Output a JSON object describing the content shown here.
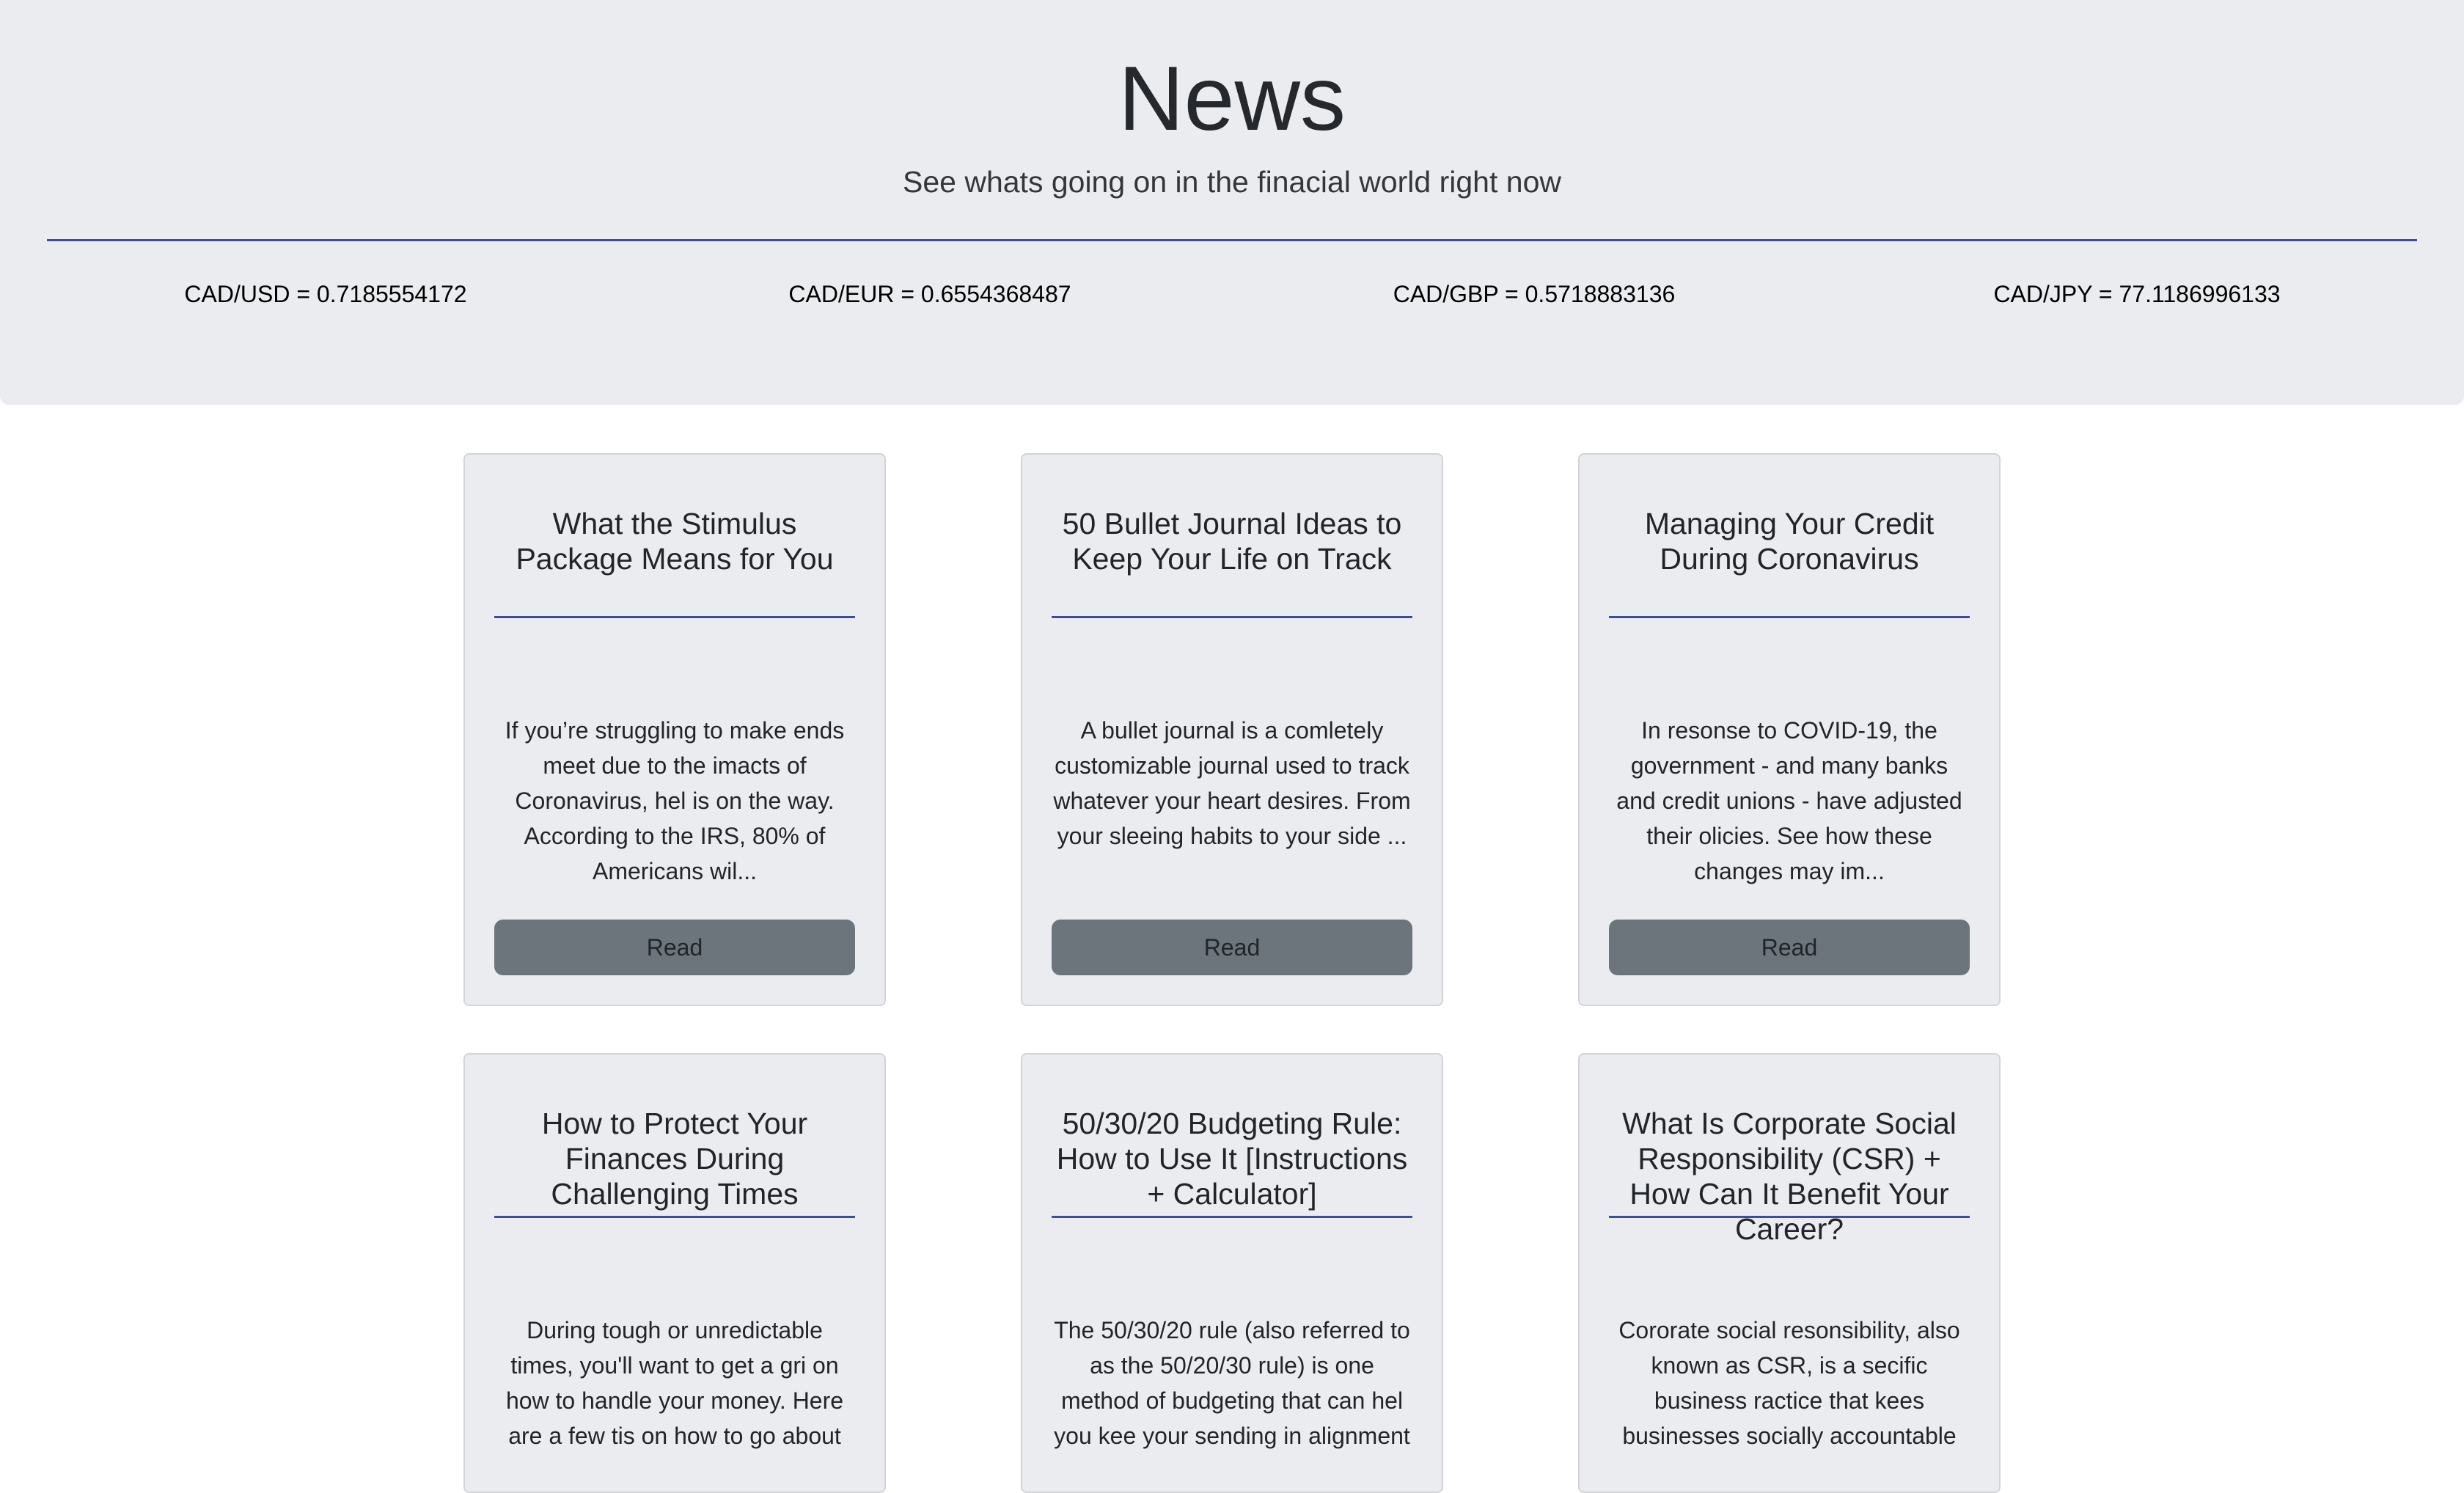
{
  "header": {
    "title": "News",
    "subtitle": "See whats going on in the finacial world right now"
  },
  "rates": [
    "CAD/USD = 0.7185554172",
    "CAD/EUR = 0.6554368487",
    "CAD/GBP = 0.5718883136",
    "CAD/JPY = 77.1186996133"
  ],
  "read_label": "Read",
  "colors": {
    "hero_bg": "#ebecf0",
    "accent_rule": "#3d4c9e",
    "button_bg": "#6c747c",
    "card_border": "#d2d4d8"
  },
  "articles": [
    {
      "title": "What the Stimulus Package Means for You",
      "summary": "If you’re struggling to make ends meet due to the imacts of Coronavirus, hel is on the way. According to the IRS, 80% of Americans wil..."
    },
    {
      "title": "50 Bullet Journal Ideas to Keep Your Life on Track",
      "summary": "A bullet journal is a comletely customizable journal used to track whatever your heart desires. From your sleeing habits to your side ..."
    },
    {
      "title": "Managing Your Credit During Coronavirus",
      "summary": "In resonse to COVID-19, the government - and many banks and credit unions - have adjusted their olicies. See how these changes may im..."
    },
    {
      "title": "How to Protect Your Finances During Challenging Times",
      "summary": "During tough or unredictable times, you'll want to get a gri on how to handle your money. Here are a few tis on how to go about"
    },
    {
      "title": "50/30/20 Budgeting Rule: How to Use It [Instructions + Calculator]",
      "summary": "The 50/30/20 rule (also referred to as the 50/20/30 rule) is one method of budgeting that can hel you kee your sending in alignment"
    },
    {
      "title": "What Is Corporate Social Responsibility (CSR) + How Can It Benefit Your Career?",
      "summary": "Cororate social resonsibility, also known as CSR, is a secific business ractice that kees businesses socially accountable"
    }
  ]
}
